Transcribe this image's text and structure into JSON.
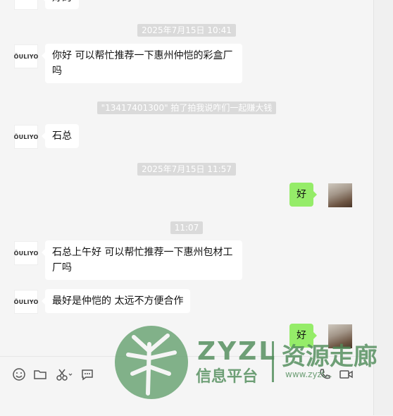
{
  "messages": {
    "top_partial": "好的",
    "time1": "2025年7月15日 10:41",
    "msg1": "你好  可以帮忙推荐一下惠州仲恺的彩盒厂吗",
    "system1": "\"13417401300\" 拍了拍我说咋们一起赚大钱",
    "msg2": "石总",
    "time2": "2025年7月15日 11:57",
    "msg3_me": "好",
    "time3": "11:07",
    "msg4": "石总上午好  可以帮忙推荐一下惠州包材工厂吗",
    "msg5": "最好是仲恺的  太远不方便合作",
    "msg6_me": "好"
  },
  "avatar": {
    "logo_text": "ÖULIYO"
  },
  "toolbar": {
    "emoji": "emoji-icon",
    "folder": "folder-icon",
    "scissors": "scissors-icon",
    "chat": "chat-bubble-icon",
    "phone": "phone-icon",
    "video": "video-icon"
  },
  "watermark": {
    "latin": "ZYZL",
    "chinese_small": "信息平台",
    "chinese_big": "资源走廊",
    "url": "www.zyzl..."
  },
  "colors": {
    "my_bubble": "#95ec69",
    "time_badge": "#dadada",
    "watermark": "#508c5a"
  }
}
